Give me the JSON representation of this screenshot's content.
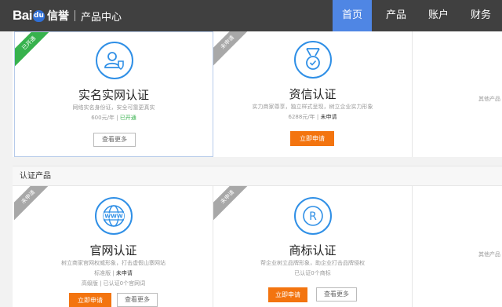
{
  "header": {
    "logo_bai": "Bai",
    "logo_du": "du",
    "logo_xinyu": "信誉",
    "logo_center": "产品中心",
    "nav": [
      "首页",
      "产品",
      "账户",
      "财务"
    ]
  },
  "row1": {
    "card1": {
      "ribbon": "已开通",
      "icon": "user-shield-icon",
      "title": "实名实网认证",
      "desc": "网络实名身份证，安全可靠更真实",
      "price": "600元/年",
      "status": "已开通",
      "btn": "查看更多"
    },
    "card2": {
      "ribbon": "未申请",
      "icon": "medal-icon",
      "title": "资信认证",
      "desc": "实力商家尊享，独立样式呈现，树立企业实力形象",
      "price": "6288元/年",
      "status": "未申请",
      "btn": "立即申请"
    },
    "side": "其他产品"
  },
  "section_title": "认证产品",
  "row2": {
    "card1": {
      "ribbon": "未申请",
      "icon": "globe-www-icon",
      "title": "官网认证",
      "desc": "树立商家官网权威形象，打击虚假山寨网站",
      "line1_label": "标准版",
      "line1_status": "未申请",
      "line2": "高级版 | 已认证0个官网词",
      "btn_primary": "立即申请",
      "btn_outline": "查看更多"
    },
    "card2": {
      "ribbon": "未申请",
      "icon": "registered-trademark-icon",
      "title": "商标认证",
      "desc": "帮企业树立品牌形象，助企业打击品牌侵权",
      "line1": "已认证0个商标",
      "btn_primary": "立即申请",
      "btn_outline": "查看更多"
    },
    "side": "其他产品"
  },
  "colors": {
    "topbar": "#404040",
    "nav_active": "#4f86e4",
    "accent_orange": "#f3740f",
    "icon_blue": "#2f8fe6",
    "ribbon_green": "#37b24d",
    "ribbon_gray": "#a8a8a8"
  }
}
